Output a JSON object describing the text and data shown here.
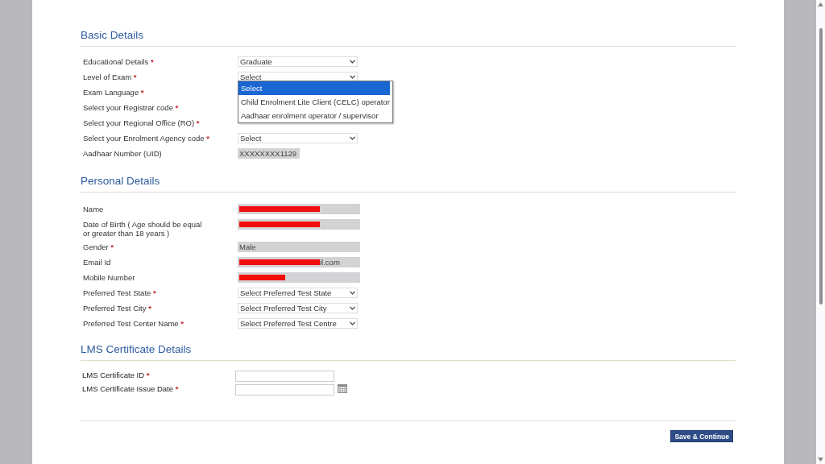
{
  "sections": [
    {
      "title": "Basic Details",
      "rows": [
        {
          "label": "Educational Details",
          "mark": "*",
          "kind": "select",
          "value": "Graduate"
        },
        {
          "label": "Level of Exam",
          "mark": "*",
          "kind": "select",
          "value": "Select",
          "expanded": true,
          "options": [
            {
              "label": "Select",
              "selected": true
            },
            {
              "label": "Child Enrolment Lite Client (CELC) operator",
              "selected": false
            },
            {
              "label": "Aadhaar enrolment operator / supervisor",
              "selected": false
            }
          ]
        },
        {
          "label": "Exam Language",
          "mark": "*",
          "kind": "covered"
        },
        {
          "label": "Select your Registrar code",
          "mark": "*",
          "kind": "covered"
        },
        {
          "label": "Select your Regional Office (RO)",
          "mark": "*",
          "kind": "covered"
        },
        {
          "label": "Select your Enrolment Agency code",
          "mark": "*",
          "kind": "select",
          "value": "Select"
        },
        {
          "label": "Aadhaar Number (UID)",
          "kind": "readonly",
          "value": "XXXXXXXX1129",
          "short": true
        }
      ]
    },
    {
      "title": "Personal Details",
      "rows": [
        {
          "label": "Name",
          "kind": "readonly",
          "redacted": true
        },
        {
          "label": "Date of Birth ( Age should be equal or greater than 18 years )",
          "kind": "readonly",
          "redacted": true
        },
        {
          "label": "Gender",
          "mark": "*",
          "kind": "readonly",
          "value": "Male"
        },
        {
          "label": "Email Id",
          "kind": "readonly",
          "redacted": true,
          "value": "il.com"
        },
        {
          "label": "Mobile Number",
          "kind": "readonly",
          "redacted": true,
          "short": true
        },
        {
          "label": "Preferred Test State",
          "mark": "*",
          "kind": "select",
          "value": "Select Preferred Test State"
        },
        {
          "label": "Preferred Test City",
          "mark": "*",
          "kind": "select",
          "value": "Select Preferred Test City"
        },
        {
          "label": "Preferred Test Center Name",
          "mark": "*",
          "kind": "select",
          "value": "Select Preferred Test Centre"
        }
      ]
    },
    {
      "title": "LMS Certificate Details",
      "rows": [
        {
          "label": "LMS Certificate ID",
          "mark": "*",
          "kind": "input"
        },
        {
          "label": "LMS Certificate Issue Date",
          "mark": "*",
          "kind": "input",
          "calendar": true
        }
      ]
    }
  ],
  "button": "Save & Continue"
}
